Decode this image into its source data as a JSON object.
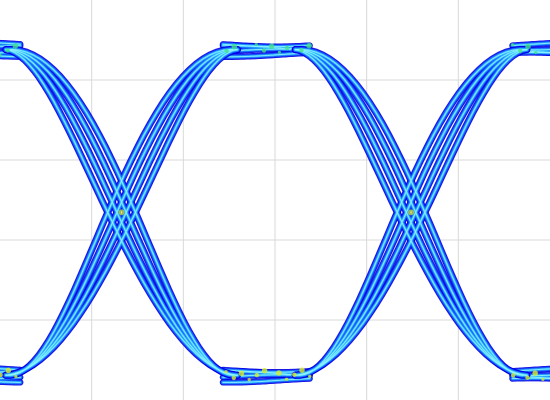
{
  "chart_data": {
    "type": "eye-diagram",
    "title": "",
    "xlabel": "",
    "ylabel": "",
    "grid": true,
    "grid_columns": 6,
    "grid_rows": 5,
    "x_range": [
      0,
      1.9
    ],
    "y_range": [
      -0.03,
      1.1
    ],
    "crossing_points_ui": [
      0.42,
      1.42
    ],
    "crossing_level": 0.5,
    "high_level": 0.96,
    "low_level": 0.04,
    "unit_interval": 1,
    "intensity_colormap": [
      "#0000e6",
      "#1a6bff",
      "#33c4ff",
      "#8ff2ff",
      "#3ee08a",
      "#d6ef2a"
    ]
  }
}
